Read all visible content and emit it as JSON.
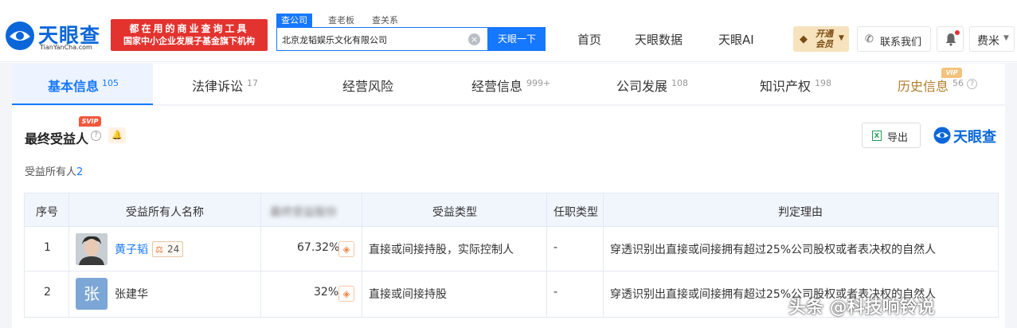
{
  "brand": {
    "name": "天眼查",
    "domain": "TianYanCha.com",
    "color": "#0b67d9"
  },
  "banner": {
    "line1": "都在用的商业查询工具",
    "line2": "国家中小企业发展子基金旗下机构",
    "color": "#e3332f"
  },
  "search": {
    "tabs": [
      {
        "label": "查公司",
        "active": true
      },
      {
        "label": "查老板",
        "active": false
      },
      {
        "label": "查关系",
        "active": false
      }
    ],
    "value": "北京龙韬娱乐文化有限公司",
    "button_label": "天眼一下"
  },
  "nav": {
    "items": [
      "首页",
      "天眼数据",
      "天眼AI"
    ],
    "vip_label": "开通会员",
    "contact_label": "联系我们",
    "user_name": "费米"
  },
  "tabs": [
    {
      "label": "基本信息",
      "count": "105",
      "active": true
    },
    {
      "label": "法律诉讼",
      "count": "17"
    },
    {
      "label": "经营风险",
      "count": ""
    },
    {
      "label": "经营信息",
      "count": "999+"
    },
    {
      "label": "公司发展",
      "count": "108"
    },
    {
      "label": "知识产权",
      "count": "198"
    },
    {
      "label": "历史信息",
      "count": "56",
      "badge": "VIP"
    }
  ],
  "section": {
    "title": "最终受益人",
    "badge": "SVIP",
    "export_label": "导出",
    "watermark_brand": "天眼查",
    "owners_label": "受益所有人",
    "owners_count": "2"
  },
  "table": {
    "headers": [
      "序号",
      "受益所有人名称",
      "最终受益股份",
      "受益类型",
      "任职类型",
      "判定理由"
    ],
    "rows": [
      {
        "index": "1",
        "name": "黄子韬",
        "avatar": "photo",
        "lawsuit_count": "24",
        "share": "67.32%",
        "benefit_type": "直接或间接持股，实际控制人",
        "position_type": "-",
        "reason": "穿透识别出直接或间接拥有超过25%公司股权或者表决权的自然人"
      },
      {
        "index": "2",
        "name": "张建华",
        "avatar_char": "张",
        "share": "32%",
        "benefit_type": "直接或间接持股",
        "position_type": "-",
        "reason": "穿透识别出直接或间接拥有超过25%公司股权或者表决权的自然人"
      }
    ]
  },
  "watermark": "头条 @科技响铃说",
  "icons": [
    "logo-eye-icon",
    "clear-icon",
    "diamond-icon",
    "phone-icon",
    "bell-icon",
    "help-icon",
    "alert-bell-icon",
    "excel-icon",
    "lawsuit-icon",
    "trace-icon"
  ],
  "colors": {
    "accent": "#1677ff",
    "vip_gold": "#f6e2bd",
    "svip_red": "#f1573d",
    "header_bg": "#f1f6fd"
  }
}
